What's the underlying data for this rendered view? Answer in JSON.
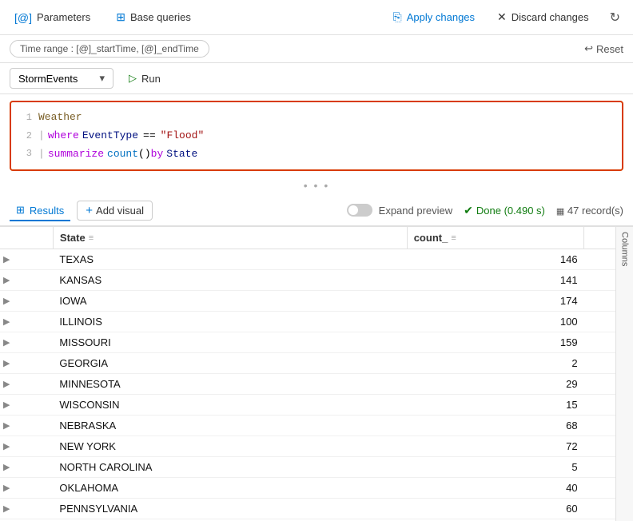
{
  "toolbar": {
    "parameters_label": "Parameters",
    "base_queries_label": "Base queries",
    "apply_changes_label": "Apply changes",
    "discard_changes_label": "Discard changes"
  },
  "time_range": {
    "label": "Time range : [@]_startTime, [@]_endTime",
    "reset_label": "Reset"
  },
  "query": {
    "database": "StormEvents",
    "run_label": "Run",
    "lines": [
      {
        "num": "1",
        "content": "Weather"
      },
      {
        "num": "2",
        "content": "| where EventType == \"Flood\""
      },
      {
        "num": "3",
        "content": "| summarize count() by State"
      }
    ]
  },
  "results": {
    "tab_label": "Results",
    "add_visual_label": "Add visual",
    "expand_preview_label": "Expand preview",
    "done_label": "Done (0.490 s)",
    "records_label": "47 record(s)"
  },
  "table": {
    "col_state": "State",
    "col_count": "count_",
    "rows": [
      {
        "state": "TEXAS",
        "count": 146
      },
      {
        "state": "KANSAS",
        "count": 141
      },
      {
        "state": "IOWA",
        "count": 174
      },
      {
        "state": "ILLINOIS",
        "count": 100
      },
      {
        "state": "MISSOURI",
        "count": 159
      },
      {
        "state": "GEORGIA",
        "count": 2
      },
      {
        "state": "MINNESOTA",
        "count": 29
      },
      {
        "state": "WISCONSIN",
        "count": 15
      },
      {
        "state": "NEBRASKA",
        "count": 68
      },
      {
        "state": "NEW YORK",
        "count": 72
      },
      {
        "state": "NORTH CAROLINA",
        "count": 5
      },
      {
        "state": "OKLAHOMA",
        "count": 40
      },
      {
        "state": "PENNSYLVANIA",
        "count": 60
      }
    ],
    "columns_label": "Columns"
  }
}
